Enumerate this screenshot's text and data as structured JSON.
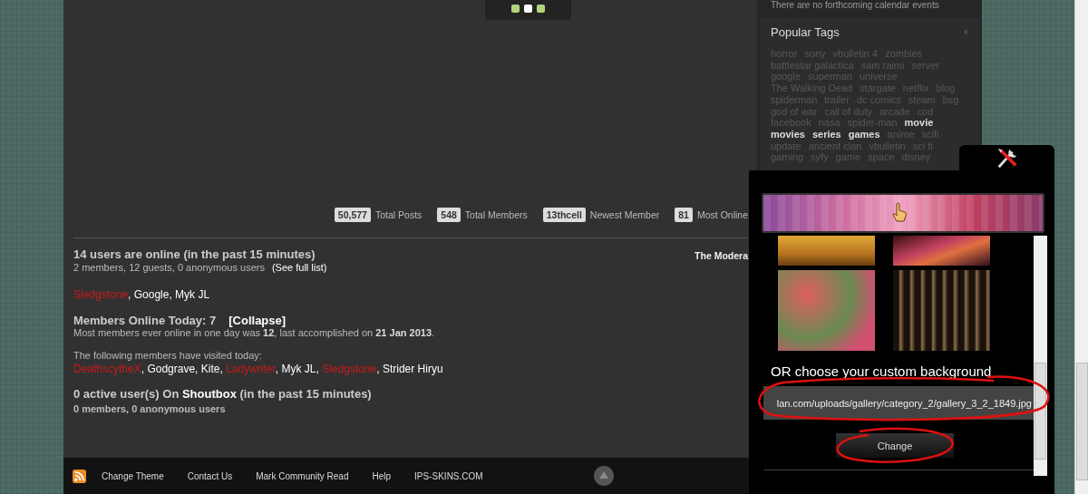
{
  "slider_dots": [
    {
      "selected": false
    },
    {
      "selected": true
    },
    {
      "selected": false
    }
  ],
  "calendar": {
    "message": "There are no forthcoming calendar events"
  },
  "popular_tags": {
    "title": "Popular Tags",
    "close": "×",
    "tags": [
      {
        "label": "horror",
        "popular": false
      },
      {
        "label": "sony",
        "popular": false
      },
      {
        "label": "vbulletin 4",
        "popular": false
      },
      {
        "label": "zombies",
        "popular": false
      },
      {
        "label": "battlestar galactica",
        "popular": false
      },
      {
        "label": "sam raimi",
        "popular": false
      },
      {
        "label": "server",
        "popular": false
      },
      {
        "label": "google",
        "popular": false
      },
      {
        "label": "superman",
        "popular": false
      },
      {
        "label": "universe",
        "popular": false
      },
      {
        "label": "The Walking Dead",
        "popular": false
      },
      {
        "label": "stargate",
        "popular": false
      },
      {
        "label": "netflix",
        "popular": false
      },
      {
        "label": "blog",
        "popular": false
      },
      {
        "label": "spiderman",
        "popular": false
      },
      {
        "label": "trailer",
        "popular": false
      },
      {
        "label": "dc comics",
        "popular": false
      },
      {
        "label": "steam",
        "popular": false
      },
      {
        "label": "bsg",
        "popular": false
      },
      {
        "label": "god of war",
        "popular": false
      },
      {
        "label": "call of duty",
        "popular": false
      },
      {
        "label": "arcade",
        "popular": false
      },
      {
        "label": "cod",
        "popular": false
      },
      {
        "label": "facebook",
        "popular": false
      },
      {
        "label": "nasa",
        "popular": false
      },
      {
        "label": "spider-man",
        "popular": false
      },
      {
        "label": "movie",
        "popular": true
      },
      {
        "label": "movies",
        "popular": true
      },
      {
        "label": "series",
        "popular": true
      },
      {
        "label": "games",
        "popular": true
      },
      {
        "label": "anime",
        "popular": false
      },
      {
        "label": "scifi",
        "popular": false
      },
      {
        "label": "update",
        "popular": false
      },
      {
        "label": "ancient clan",
        "popular": false
      },
      {
        "label": "vbulletin",
        "popular": false
      },
      {
        "label": "sci fi",
        "popular": false
      },
      {
        "label": "gaming",
        "popular": false
      },
      {
        "label": "syfy",
        "popular": false
      },
      {
        "label": "game",
        "popular": false
      },
      {
        "label": "space",
        "popular": false
      },
      {
        "label": "disney",
        "popular": false
      }
    ]
  },
  "stats": [
    {
      "value": "50,577",
      "label": "Total Posts"
    },
    {
      "value": "548",
      "label": "Total Members"
    },
    {
      "value": "13thcell",
      "label": "Newest Member"
    },
    {
      "value": "81",
      "label": "Most Online"
    }
  ],
  "online": {
    "title": "14 users are online (in the past 15 minutes)",
    "summary": "2 members, 12 guests, 0 anonymous users",
    "full_list_link": "(See full list)",
    "moderators_label": "The Modera",
    "separator": ", ",
    "users": [
      {
        "name": "Sledgstone",
        "color": "#cc1a1a"
      },
      {
        "name": "Google",
        "color": "#ffffff"
      },
      {
        "name": "Myk JL",
        "color": "#ffffff"
      }
    ]
  },
  "today": {
    "title": "Members Online Today: 7",
    "collapse_link": "[Collapse]",
    "record": "Most members ever online in one day was **12**, last accomplished on **21 Jan 2013**.",
    "visited_label": "The following members have visited today:",
    "users": [
      {
        "name": "DeathscytheX",
        "color": "#cc1a1a"
      },
      {
        "name": "Godgrave",
        "color": "#ffffff"
      },
      {
        "name": "Kite",
        "color": "#ffffff"
      },
      {
        "name": "Ladywriter",
        "color": "#cc1a1a"
      },
      {
        "name": "Myk JL",
        "color": "#ffffff"
      },
      {
        "name": "Sledgstone",
        "color": "#cc1a1a"
      },
      {
        "name": "Strider Hiryu",
        "color": "#ffffff"
      }
    ]
  },
  "shoutbox": {
    "title": "0 active user(s) On **Shoutbox** (in the past 15 minutes)",
    "summary": "0 members, 0 anonymous users"
  },
  "footer": {
    "links": [
      "Change Theme",
      "Contact Us",
      "Mark Community Read",
      "Help",
      "IPS-SKINS.COM"
    ]
  },
  "background_picker": {
    "custom_label": "OR choose your custom background",
    "url_value": "lan.com/uploads/gallery/category_2/gallery_3_2_1849.jpg",
    "button": "Change"
  }
}
